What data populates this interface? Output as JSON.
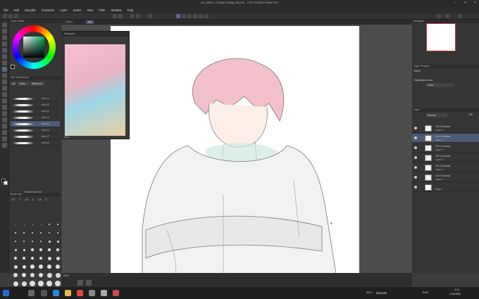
{
  "app": {
    "title": "xxx (2000 × 2000px 300dpi 25.0%) - CLIP STUDIO PAINT EX"
  },
  "menu": [
    "File",
    "Edit",
    "Story(R)",
    "Animation",
    "Layer",
    "Select",
    "View",
    "Filter",
    "Window",
    "Help"
  ],
  "tabs": [
    "Layer",
    "xxx"
  ],
  "left_panel": {
    "color_wheel_title": "Color Wheel",
    "brush_panel_title": "Sub Tool [Brush]",
    "brush_tabs": [
      "Ink",
      "Textur...",
      "Watercolor"
    ],
    "brushes": [
      "แปรง 1",
      "แปรง 2",
      "แปรง 3",
      "แปรง 4",
      "แปรง 5",
      "แปรง 6",
      "แปรง 7",
      "แปรง 8"
    ],
    "add_sub_tool": "Add sub tool",
    "brush_size_title": "Brush size",
    "sizes": [
      "0.7",
      "1",
      "1.5",
      "2",
      "2.5",
      "3"
    ]
  },
  "reference_window": {
    "title": "Navigator",
    "zoom": "23.8"
  },
  "right_panel": {
    "navigator_title": "Navigator",
    "layer_property_title": "Layer Property",
    "effect_label": "Effect",
    "expression_label": "Expression color",
    "expression_value": "Color",
    "layer_title": "Layer",
    "blend_mode": "Normal",
    "opacity": "100",
    "layers": [
      {
        "a": "100 % Normal",
        "b": "Layer 6"
      },
      {
        "a": "100 % Normal",
        "b": "Layer 4"
      },
      {
        "a": "100 % Normal",
        "b": "Layer 3"
      },
      {
        "a": "100 % Normal",
        "b": "Layer 5"
      },
      {
        "a": "100 % Normal",
        "b": "Layer 1"
      },
      {
        "a": "100 % Normal",
        "b": "Layer 2"
      },
      {
        "a": "",
        "b": "Paper"
      }
    ],
    "selected_layer": 1
  },
  "statusbar": {
    "zoom": "23.8"
  },
  "taskbar": {
    "weather": "26°C",
    "weather_desc": "มีแดดจัด",
    "lang": "ENG",
    "time": "3:14",
    "date": "17/8/2563"
  },
  "colors": {
    "accent": "#4b5a75",
    "canvas": "#ffffff",
    "panel": "#353535"
  }
}
